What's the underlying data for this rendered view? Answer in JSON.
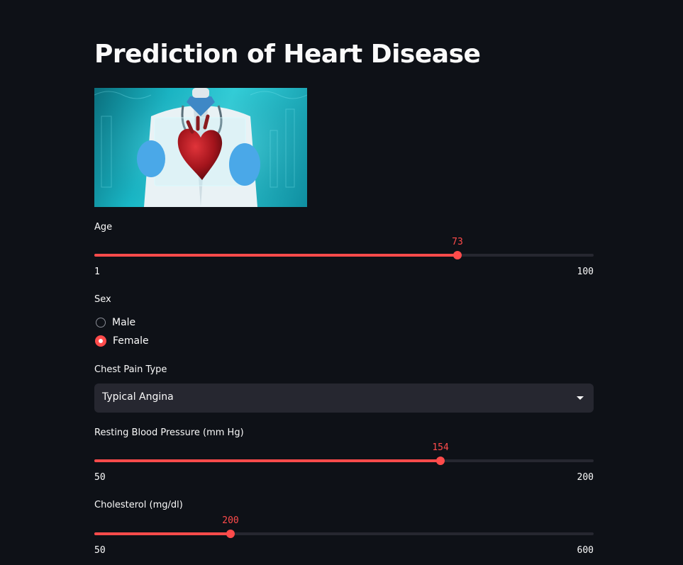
{
  "page": {
    "title": "Prediction of Heart Disease",
    "background": "#0e1117",
    "accent": "#ff4b4b"
  },
  "image": {
    "alt": "doctor holding heart"
  },
  "age": {
    "label": "Age",
    "value": "73",
    "min": "1",
    "max": "100"
  },
  "sex": {
    "label": "Sex",
    "options": [
      {
        "label": "Male",
        "selected": false
      },
      {
        "label": "Female",
        "selected": true
      }
    ]
  },
  "chest_pain": {
    "label": "Chest Pain Type",
    "selected": "Typical Angina",
    "icon": "chevron-down-icon"
  },
  "resting_bp": {
    "label": "Resting Blood Pressure (mm Hg)",
    "value": "154",
    "min": "50",
    "max": "200"
  },
  "cholesterol": {
    "label": "Cholesterol (mg/dl)",
    "value": "200",
    "min": "50",
    "max": "600"
  }
}
